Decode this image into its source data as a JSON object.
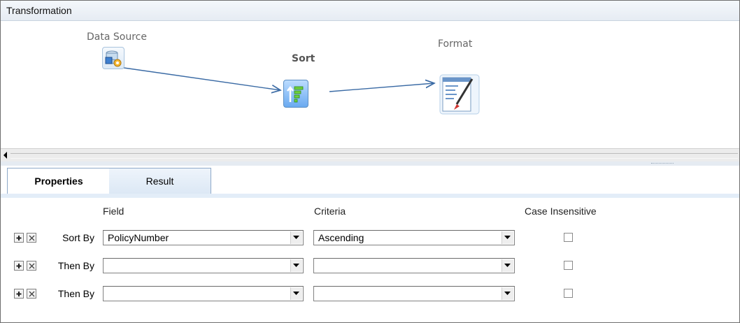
{
  "window": {
    "title": "Transformation"
  },
  "nodes": {
    "data_source": {
      "label": "Data Source"
    },
    "sort": {
      "label": "Sort"
    },
    "format": {
      "label": "Format"
    }
  },
  "tabs": [
    {
      "label": "Properties",
      "active": true
    },
    {
      "label": "Result",
      "active": false
    }
  ],
  "grid": {
    "headers": {
      "field": "Field",
      "criteria": "Criteria",
      "case": "Case Insensitive"
    },
    "rows": [
      {
        "label": "Sort By",
        "field": "PolicyNumber",
        "criteria": "Ascending",
        "case_insensitive": false
      },
      {
        "label": "Then By",
        "field": "",
        "criteria": "",
        "case_insensitive": false
      },
      {
        "label": "Then By",
        "field": "",
        "criteria": "",
        "case_insensitive": false
      }
    ]
  },
  "colors": {
    "connector": "#3b6ba5",
    "tab_border": "#8ea9c9",
    "selected_node": "#6aaaf0"
  }
}
